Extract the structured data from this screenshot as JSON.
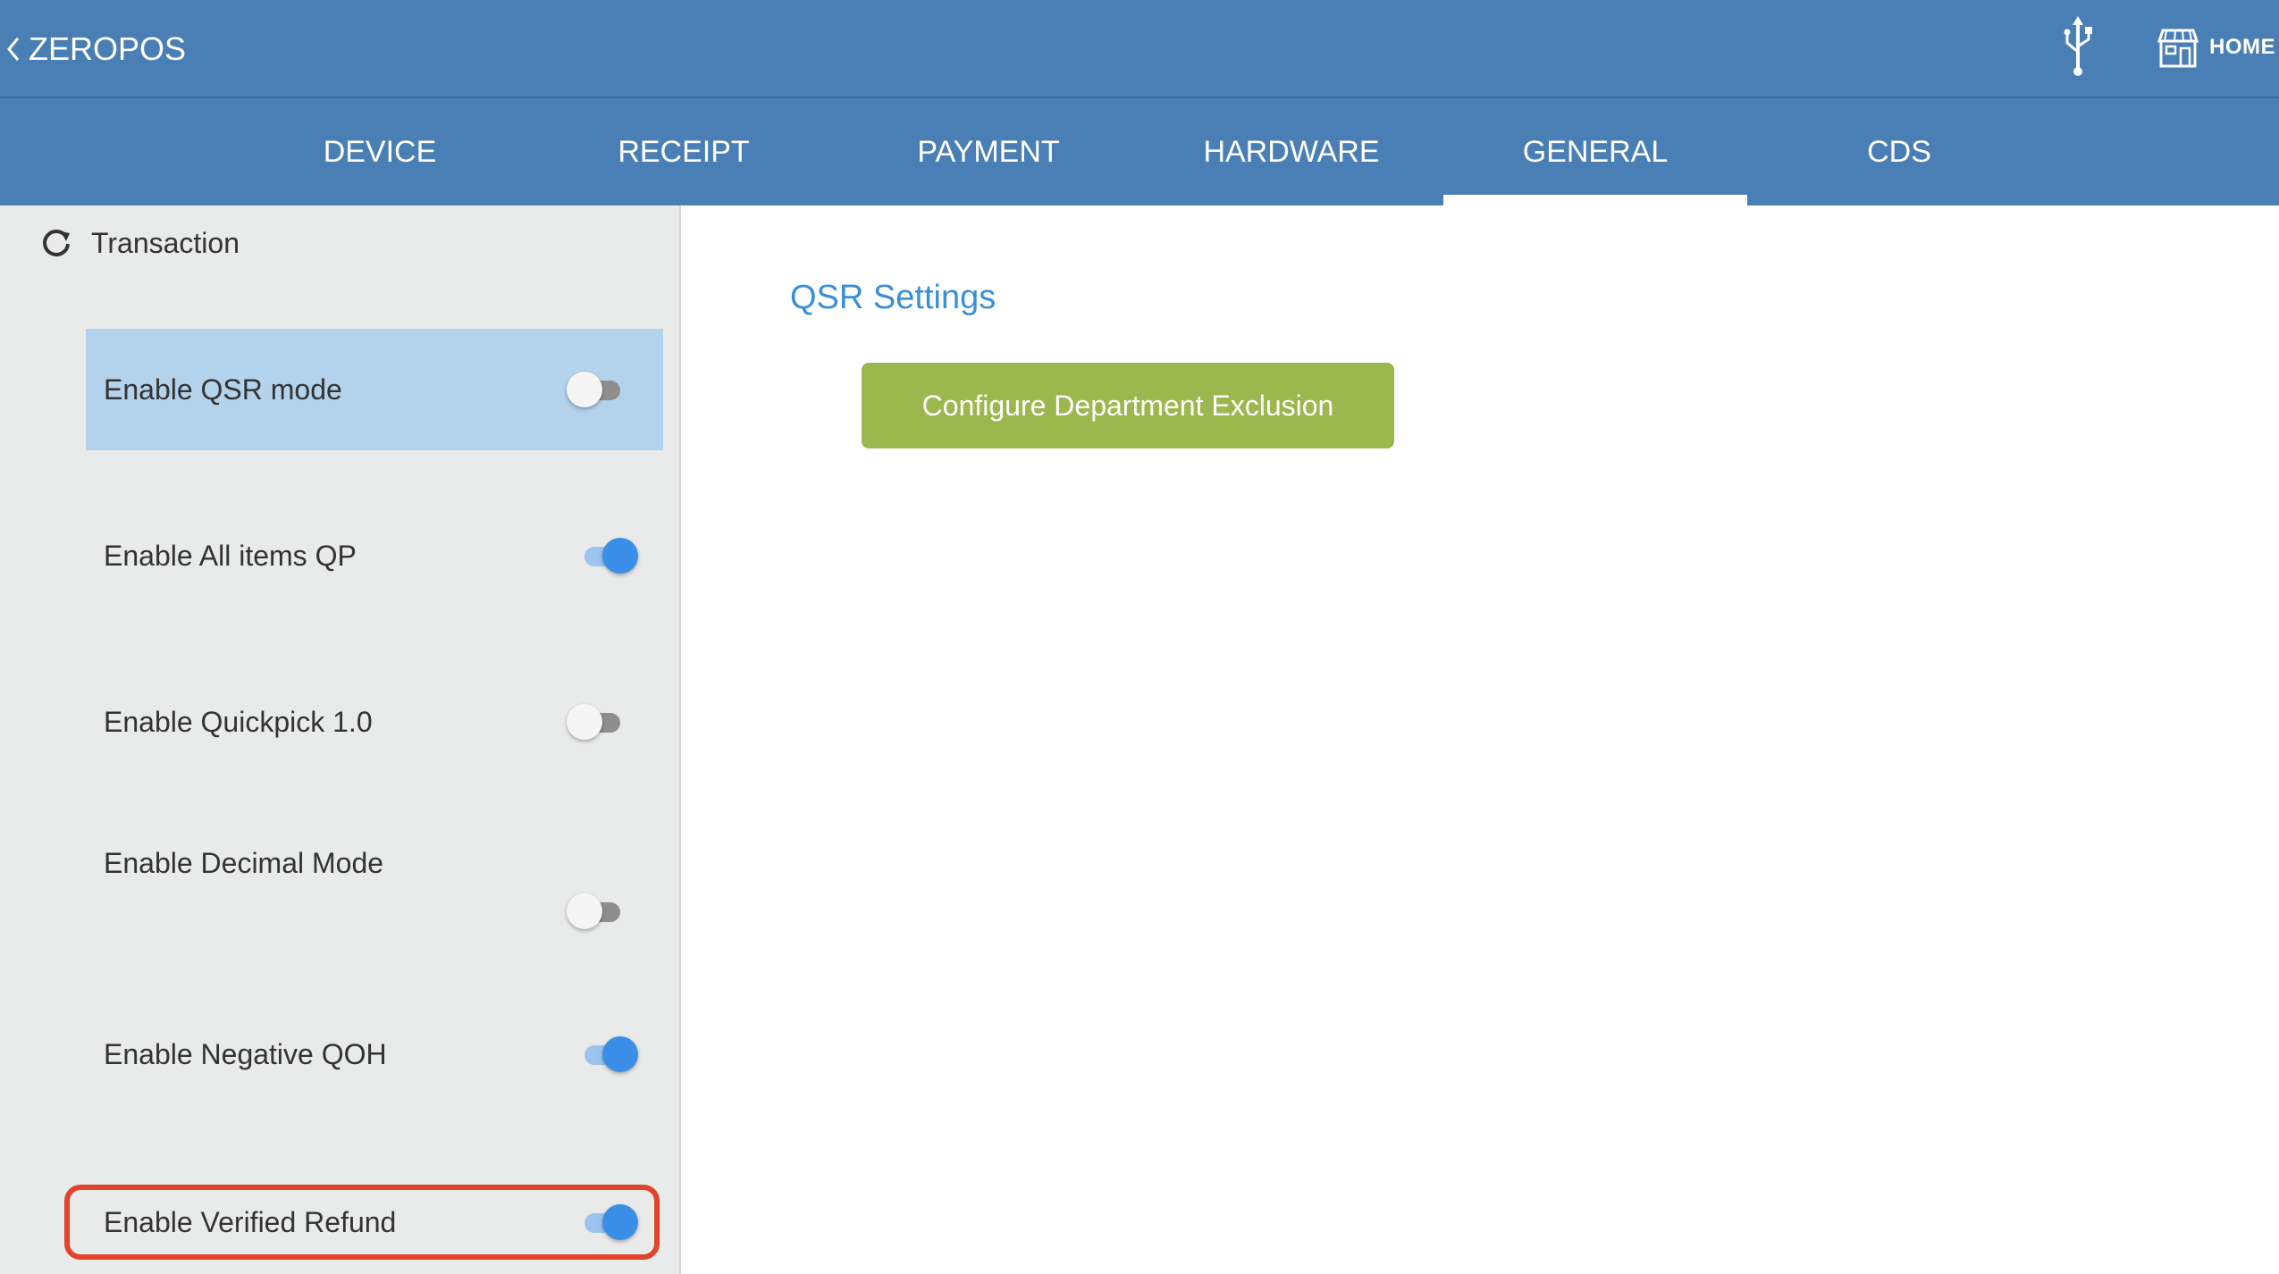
{
  "app": {
    "back_label": "ZEROPOS",
    "home_label": "HOME"
  },
  "tabs": [
    {
      "label": "DEVICE"
    },
    {
      "label": "RECEIPT"
    },
    {
      "label": "PAYMENT"
    },
    {
      "label": "HARDWARE"
    },
    {
      "label": "GENERAL",
      "active": true
    },
    {
      "label": "CDS"
    }
  ],
  "sidebar": {
    "section_title": "Transaction",
    "items": [
      {
        "label": "Enable QSR mode",
        "on": false,
        "selected": true
      },
      {
        "label": "Enable All items QP",
        "on": true
      },
      {
        "label": "Enable Quickpick 1.0",
        "on": false
      },
      {
        "label": "Enable Decimal Mode",
        "on": false
      },
      {
        "label": "Enable Negative QOH",
        "on": true
      },
      {
        "label": "Enable Verified Refund",
        "on": true,
        "highlighted": true
      }
    ]
  },
  "main": {
    "section_title": "QSR Settings",
    "button_label": "Configure Department Exclusion"
  },
  "colors": {
    "header": "#4a7fb5",
    "toggle_on": "#3b8ee8",
    "button": "#9bb84f",
    "highlight_border": "#e2432a"
  }
}
